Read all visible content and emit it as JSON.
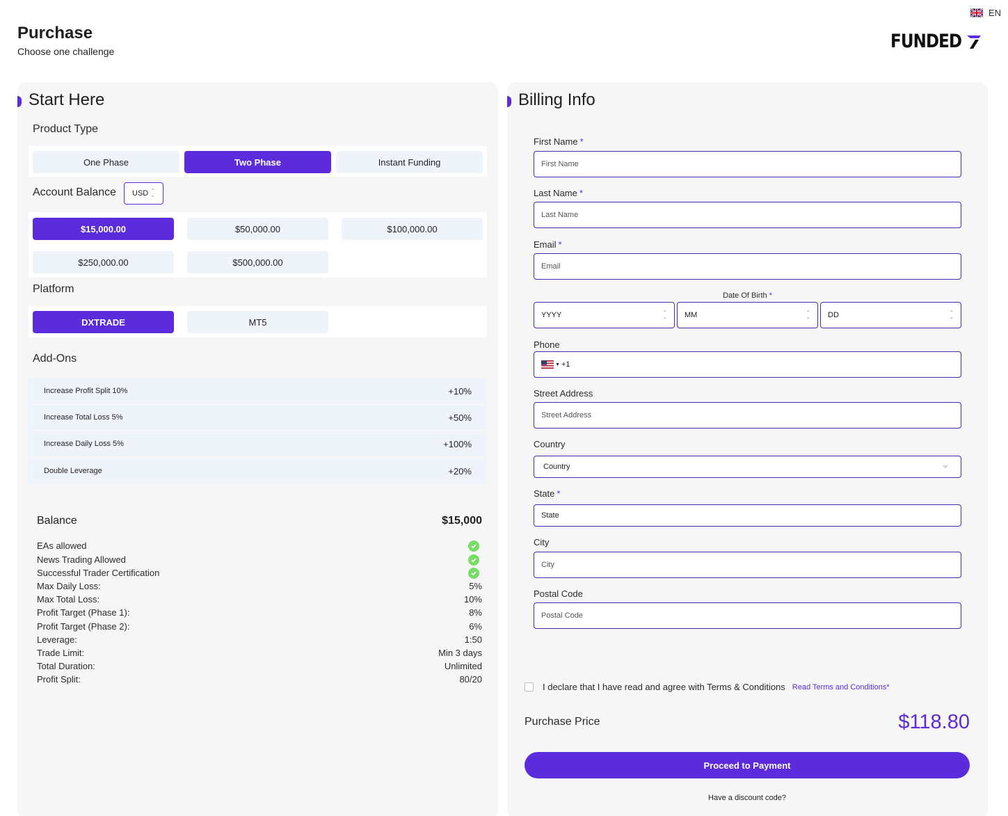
{
  "lang": {
    "code": "EN"
  },
  "header": {
    "title": "Purchase",
    "subtitle": "Choose one challenge"
  },
  "logo": {
    "text": "FUNDED"
  },
  "left": {
    "title": "Start Here",
    "product_type": {
      "label": "Product Type",
      "options": [
        "One Phase",
        "Two Phase",
        "Instant Funding"
      ],
      "selected": "Two Phase"
    },
    "account_balance": {
      "label": "Account Balance",
      "currency": "USD",
      "options": [
        "$15,000.00",
        "$50,000.00",
        "$100,000.00",
        "$250,000.00",
        "$500,000.00"
      ],
      "selected": "$15,000.00"
    },
    "platform": {
      "label": "Platform",
      "options": [
        "DXTRADE",
        "MT5"
      ],
      "selected": "DXTRADE"
    },
    "addons": {
      "label": "Add-Ons",
      "items": [
        {
          "name": "Increase Profit Split 10%",
          "price": "+10%"
        },
        {
          "name": "Increase Total Loss 5%",
          "price": "+50%"
        },
        {
          "name": "Increase Daily Loss 5%",
          "price": "+100%"
        },
        {
          "name": "Double Leverage",
          "price": "+20%"
        }
      ]
    },
    "summary": {
      "balance_label": "Balance",
      "balance_value": "$15,000",
      "specs": [
        {
          "label": "EAs allowed",
          "check": true
        },
        {
          "label": "News Trading Allowed",
          "check": true
        },
        {
          "label": "Successful Trader Certification",
          "check": true
        },
        {
          "label": "Max Daily Loss:",
          "value": "5%"
        },
        {
          "label": "Max Total Loss:",
          "value": "10%"
        },
        {
          "label": "Profit Target (Phase 1):",
          "value": "8%"
        },
        {
          "label": "Profit Target (Phase 2):",
          "value": "6%"
        },
        {
          "label": "Leverage:",
          "value": "1:50"
        },
        {
          "label": "Trade Limit:",
          "value": "Min 3 days"
        },
        {
          "label": "Total Duration:",
          "value": "Unlimited"
        },
        {
          "label": "Profit Split:",
          "value": "80/20"
        }
      ]
    }
  },
  "right": {
    "title": "Billing Info",
    "first_name": {
      "label": "First Name",
      "placeholder": "First Name"
    },
    "last_name": {
      "label": "Last Name",
      "placeholder": "Last Name"
    },
    "email": {
      "label": "Email",
      "placeholder": "Email"
    },
    "dob": {
      "label": "Date Of Birth",
      "year": "YYYY",
      "month": "MM",
      "day": "DD"
    },
    "phone": {
      "label": "Phone",
      "code": "+1"
    },
    "street": {
      "label": "Street Address",
      "placeholder": "Street Address"
    },
    "country": {
      "label": "Country",
      "value": "Country"
    },
    "state": {
      "label": "State",
      "value": "State"
    },
    "city": {
      "label": "City",
      "placeholder": "City"
    },
    "postal": {
      "label": "Postal Code",
      "placeholder": "Postal Code"
    },
    "required_mark": "*",
    "terms": {
      "text": "I declare that I have read and agree with Terms & Conditions",
      "link": "Read Terms and Conditions*"
    },
    "purchase_price": {
      "label": "Purchase Price",
      "value": "$118.80"
    },
    "pay_button": "Proceed to Payment",
    "discount": "Have a discount code?"
  },
  "colors": {
    "accent": "#5b2bdc",
    "tile": "#eff4fb",
    "panel": "#f6f6f6",
    "check": "#77dd66"
  }
}
